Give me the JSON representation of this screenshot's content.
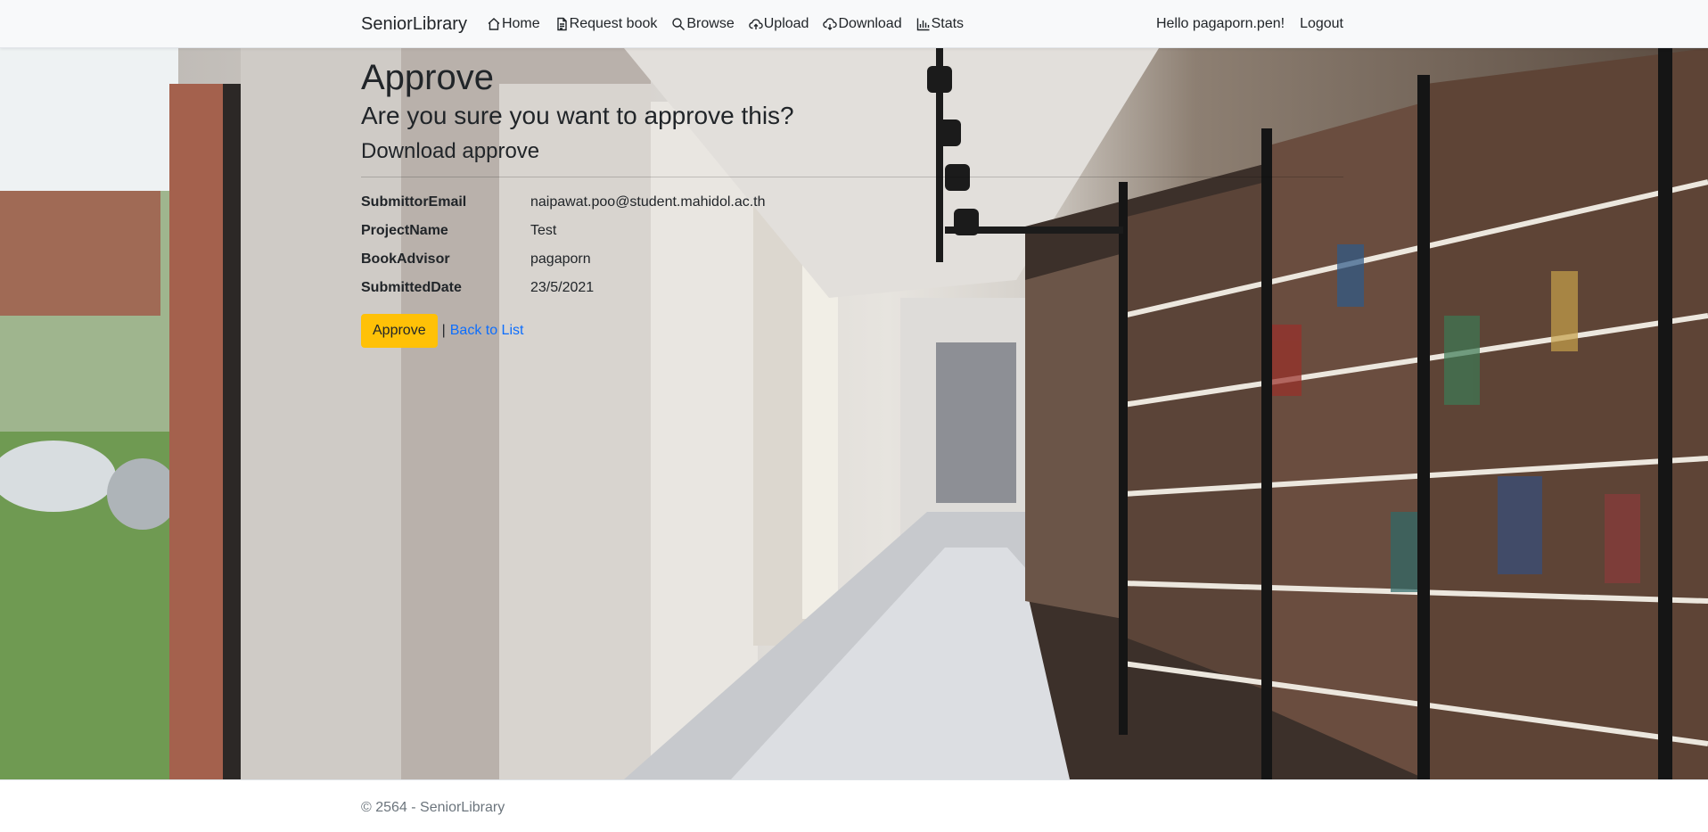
{
  "navbar": {
    "brand": "SeniorLibrary",
    "items": [
      {
        "label": "Home",
        "icon": "home-icon"
      },
      {
        "label": "Request book",
        "icon": "document-icon"
      },
      {
        "label": "Browse",
        "icon": "search-icon"
      },
      {
        "label": "Upload",
        "icon": "cloud-upload-icon"
      },
      {
        "label": "Download",
        "icon": "cloud-download-icon"
      },
      {
        "label": "Stats",
        "icon": "bar-chart-icon"
      }
    ],
    "greeting": "Hello pagaporn.pen!",
    "logout": "Logout"
  },
  "page": {
    "title": "Approve",
    "question": "Are you sure you want to approve this?",
    "subtitle": "Download approve"
  },
  "details": [
    {
      "label": "SubmittorEmail",
      "value": "naipawat.poo@student.mahidol.ac.th"
    },
    {
      "label": "ProjectName",
      "value": "Test"
    },
    {
      "label": "BookAdvisor",
      "value": "pagaporn"
    },
    {
      "label": "SubmittedDate",
      "value": "23/5/2021"
    }
  ],
  "actions": {
    "approve_label": "Approve",
    "separator": "|",
    "back_label": "Back to List"
  },
  "footer": {
    "text": "© 2564 - SeniorLibrary"
  },
  "colors": {
    "approve_button": "#ffc107",
    "link": "#0d6efd",
    "navbar_bg": "#f8f9fa"
  }
}
